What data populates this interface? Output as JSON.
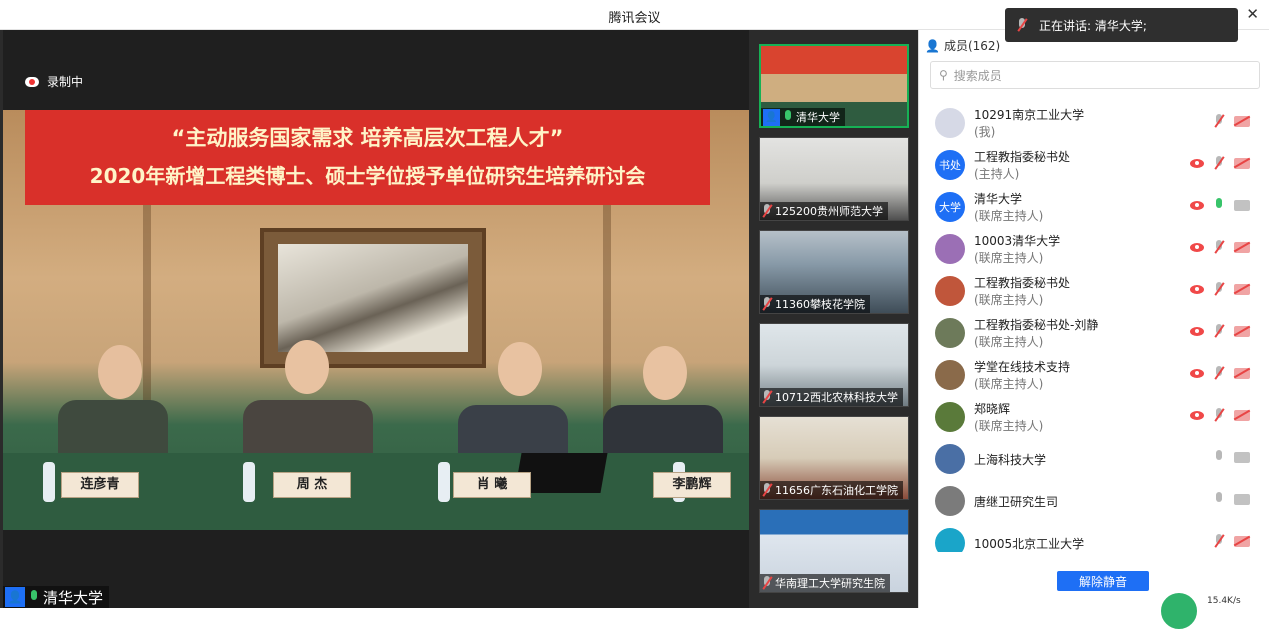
{
  "window": {
    "title": "腾讯会议",
    "close_glyph": "✕"
  },
  "main": {
    "recording_label": "录制中",
    "banner_line1": "“主动服务国家需求 培养高层次工程人才”",
    "banner_line2": "2020年新增工程类博士、硕士学位授予单位研究生培养研讨会",
    "nameplates": [
      "连彦青",
      "周 杰",
      "肖 曦",
      "李鹏辉"
    ],
    "speaker_label": "清华大学"
  },
  "thumbnails": [
    {
      "label": "清华大学",
      "active": true,
      "mic": "on"
    },
    {
      "label": "125200贵州师范大学",
      "active": false,
      "mic": "muted"
    },
    {
      "label": "11360攀枝花学院",
      "active": false,
      "mic": "muted"
    },
    {
      "label": "10712西北农林科技大学",
      "active": false,
      "mic": "muted"
    },
    {
      "label": "11656广东石油化工学院",
      "active": false,
      "mic": "muted"
    },
    {
      "label": "华南理工大学研究生院",
      "active": false,
      "mic": "muted"
    }
  ],
  "panel": {
    "title": "成员(162)",
    "speaking_text": "正在讲话: 清华大学;",
    "search_placeholder": "搜索成员",
    "members": [
      {
        "name": "10291南京工业大学",
        "role": "(我)",
        "avatar_text": "",
        "avatar_color": "#d6d9e6",
        "eye": false,
        "mic": "muted",
        "cam": "off"
      },
      {
        "name": "工程教指委秘书处",
        "role": "(主持人)",
        "avatar_text": "书处",
        "avatar_color": "#1e6ff5",
        "eye": true,
        "mic": "muted",
        "cam": "off"
      },
      {
        "name": "清华大学",
        "role": "(联席主持人)",
        "avatar_text": "大学",
        "avatar_color": "#1e6ff5",
        "eye": true,
        "mic": "on",
        "cam": "on"
      },
      {
        "name": "10003清华大学",
        "role": "(联席主持人)",
        "avatar_text": "",
        "avatar_color": "#9b6fb5",
        "eye": true,
        "mic": "muted",
        "cam": "off"
      },
      {
        "name": "工程教指委秘书处",
        "role": "(联席主持人)",
        "avatar_text": "",
        "avatar_color": "#c0563b",
        "eye": true,
        "mic": "muted",
        "cam": "off"
      },
      {
        "name": "工程教指委秘书处-刘静",
        "role": "(联席主持人)",
        "avatar_text": "",
        "avatar_color": "#6d7a5a",
        "eye": true,
        "mic": "muted",
        "cam": "off"
      },
      {
        "name": "学堂在线技术支持",
        "role": "(联席主持人)",
        "avatar_text": "",
        "avatar_color": "#8a6a4a",
        "eye": true,
        "mic": "muted",
        "cam": "off"
      },
      {
        "name": "郑晓辉",
        "role": "(联席主持人)",
        "avatar_text": "",
        "avatar_color": "#5a7a3a",
        "eye": true,
        "mic": "muted",
        "cam": "off"
      },
      {
        "name": "上海科技大学",
        "role": "",
        "avatar_text": "",
        "avatar_color": "#4a6fa5",
        "eye": false,
        "mic": "idle",
        "cam": "on"
      },
      {
        "name": "唐继卫研究生司",
        "role": "",
        "avatar_text": "",
        "avatar_color": "#7b7b7b",
        "eye": false,
        "mic": "idle",
        "cam": "on"
      },
      {
        "name": "10005北京工业大学",
        "role": "",
        "avatar_text": "",
        "avatar_color": "#1aa5c9",
        "eye": false,
        "mic": "muted",
        "cam": "off"
      }
    ],
    "unmute_label": "解除静音",
    "net_speed": "15.4K/s"
  }
}
